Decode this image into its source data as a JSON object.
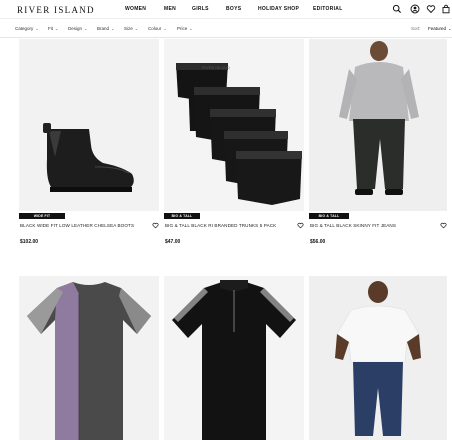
{
  "brand": {
    "logo": "RIVER ISLAND"
  },
  "nav": [
    "WOMEN",
    "MEN",
    "GIRLS",
    "BOYS",
    "HOLIDAY SHOP",
    "EDITORIAL"
  ],
  "header_icons": [
    "search-icon",
    "account-icon",
    "heart-icon",
    "bag-icon"
  ],
  "filters": [
    "Category",
    "Fit",
    "Design",
    "Brand",
    "Size",
    "Colour",
    "Price"
  ],
  "sort": {
    "label": "Sort:",
    "value": "Featured"
  },
  "products": [
    {
      "badge": "WIDE FIT",
      "title": "BLACK WIDE FIT LOW LEATHER CHELSEA BOOTS",
      "price": "$102.00"
    },
    {
      "badge": "BIG & TALL",
      "title": "BIG & TALL BLACK RI BRANDED TRUNKS 5 PACK",
      "price": "$47.00"
    },
    {
      "badge": "BIG & TALL",
      "title": "BIG & TALL BLACK SKINNY FIT JEANS",
      "price": "$56.00"
    },
    {
      "badge": "",
      "title": "",
      "price": ""
    },
    {
      "badge": "",
      "title": "",
      "price": ""
    },
    {
      "badge": "",
      "title": "",
      "price": ""
    }
  ],
  "colors": {
    "badge_bg": "#111111",
    "image_bg": "#f2f2f2"
  }
}
